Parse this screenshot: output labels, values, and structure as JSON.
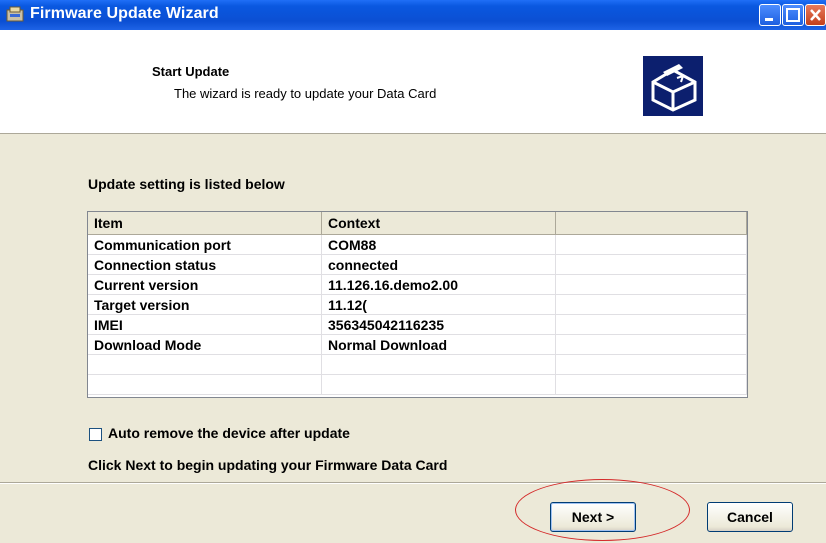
{
  "window": {
    "title": "Firmware Update Wizard"
  },
  "header": {
    "title": "Start Update",
    "subtitle": "The wizard is ready to update your Data Card"
  },
  "main": {
    "section_label": "Update setting is listed below",
    "columns": [
      "Item",
      "Context",
      ""
    ],
    "rows": [
      [
        "Communication port",
        "COM88",
        ""
      ],
      [
        "Connection status",
        "connected",
        ""
      ],
      [
        "Current version",
        "11.126.16.demo2.00",
        ""
      ],
      [
        "Target version",
        "11.12(",
        ""
      ],
      [
        "IMEI",
        "356345042116235",
        ""
      ],
      [
        "Download Mode",
        "Normal Download",
        ""
      ],
      [
        "",
        "",
        ""
      ],
      [
        "",
        "",
        ""
      ]
    ],
    "auto_remove_label": "Auto remove the device after update",
    "auto_remove_checked": false,
    "instruction": "Click Next to begin updating your Firmware Data Card"
  },
  "footer": {
    "next_label": "Next >",
    "cancel_label": "Cancel"
  },
  "colors": {
    "titlebar": "#0b4fd3",
    "annotation": "#d42a2a",
    "dialog_bg": "#ece9d8"
  }
}
